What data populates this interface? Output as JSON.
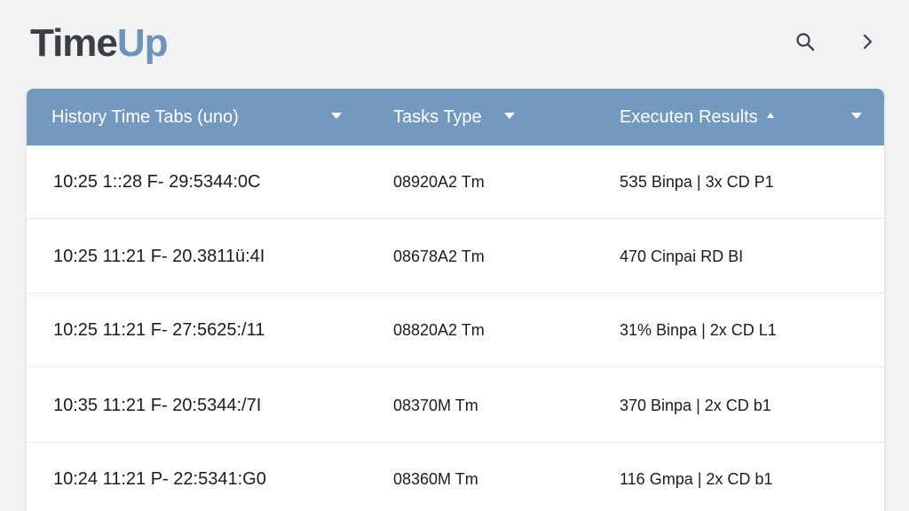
{
  "app": {
    "logo_part1": "Time",
    "logo_part2": "Up"
  },
  "header": {
    "icons": [
      "search-icon",
      "chevron-right-icon"
    ]
  },
  "table": {
    "columns": [
      "History Time Tabs (uno)",
      "Tasks Type",
      "Executen Results"
    ],
    "rows": [
      [
        "10:25 1::28 F- 29:5344:0C",
        "08920A2 Tm",
        "5З5 Binpa | 3x CD P1"
      ],
      [
        "10:25 11:21 F- 20.3811ü:4I",
        "08678A2 Tm",
        "470 Cinpai RD BI"
      ],
      [
        "10:25 11:21 F- 27:5625:/11",
        "08820A2 Tm",
        "31% Binpa | 2x CD L1"
      ],
      [
        "10:35 11:21 F- 20:5344:/7I",
        "08370M Tm",
        "370 Binpa | 2x CD b1"
      ],
      [
        "10:24 11:21 P- 22:5341:G0",
        "08360M Tm",
        "116 Gmpa | 2x CD b1"
      ]
    ]
  },
  "colors": {
    "header_bg": "#7399be",
    "logo_dark": "#3a3f45",
    "logo_accent": "#6f93b8",
    "page_bg": "#f1f2f4"
  }
}
